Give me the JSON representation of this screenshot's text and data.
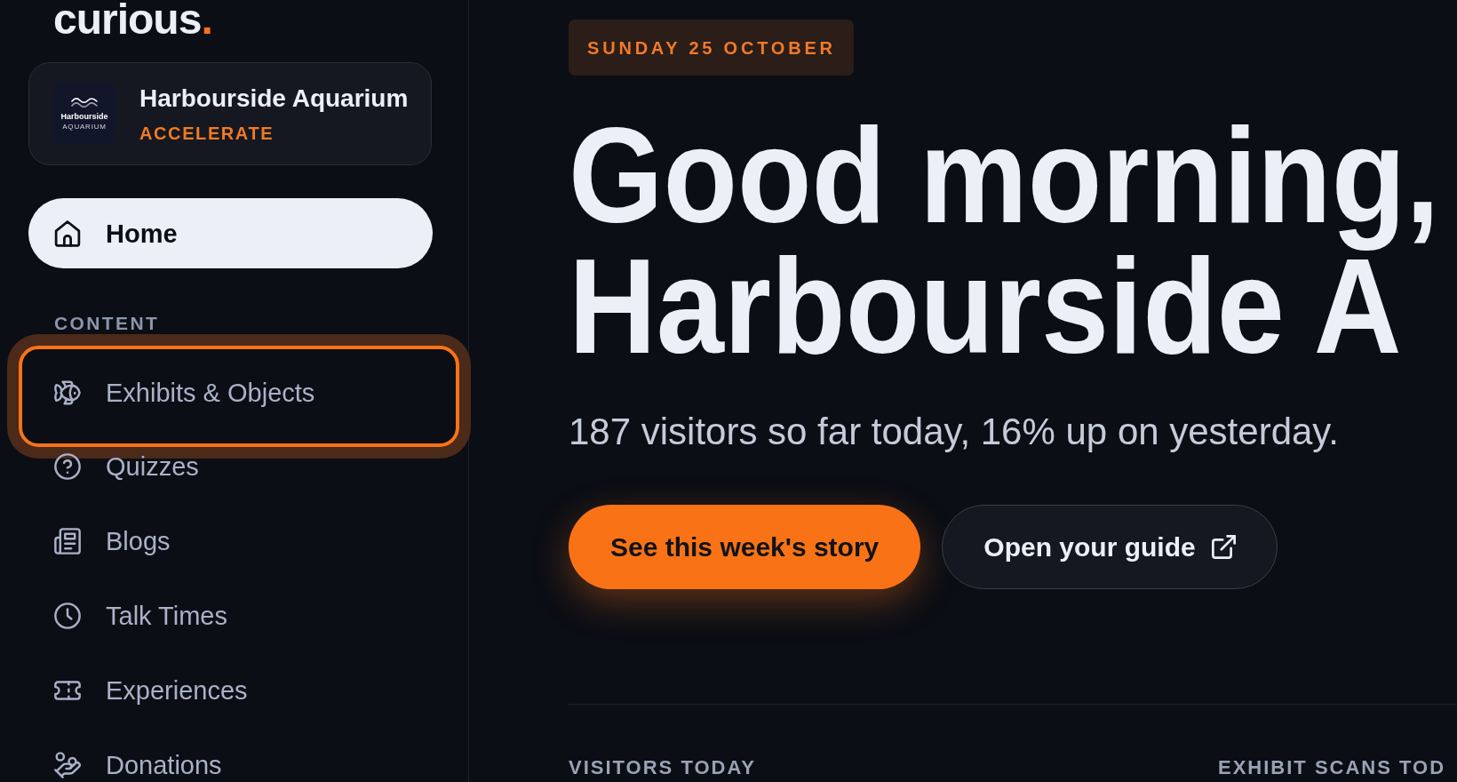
{
  "sidebar": {
    "logo": {
      "text": "curious",
      "dot": "."
    },
    "org": {
      "logo": {
        "name": "Harbourside",
        "tagline": "AQUARIUM"
      },
      "name": "Harbourside Aquarium",
      "plan": "ACCELERATE"
    },
    "nav": [
      {
        "label": "Home",
        "selected": true,
        "focused": false
      }
    ],
    "sections": [
      {
        "title": "CONTENT",
        "items": [
          {
            "label": "Exhibits & Objects",
            "selected": false,
            "focused": true
          },
          {
            "label": "Quizzes",
            "selected": false,
            "focused": false
          },
          {
            "label": "Blogs",
            "selected": false,
            "focused": false
          },
          {
            "label": "Talk Times",
            "selected": false,
            "focused": false
          },
          {
            "label": "Experiences",
            "selected": false,
            "focused": false
          },
          {
            "label": "Donations",
            "selected": false,
            "focused": false
          }
        ]
      }
    ]
  },
  "main": {
    "date": "SUNDAY 25 OCTOBER",
    "headline": "Good morning, Harbourside A",
    "summary": "187 visitors so far today, 16% up on yesterday.",
    "actions": [
      {
        "label": "See this week's story",
        "kind": "primary"
      },
      {
        "label": "Open your guide",
        "kind": "external"
      }
    ],
    "stats": [
      {
        "label": "VISITORS TODAY"
      },
      {
        "label": "EXHIBIT SCANS TOD"
      }
    ]
  }
}
